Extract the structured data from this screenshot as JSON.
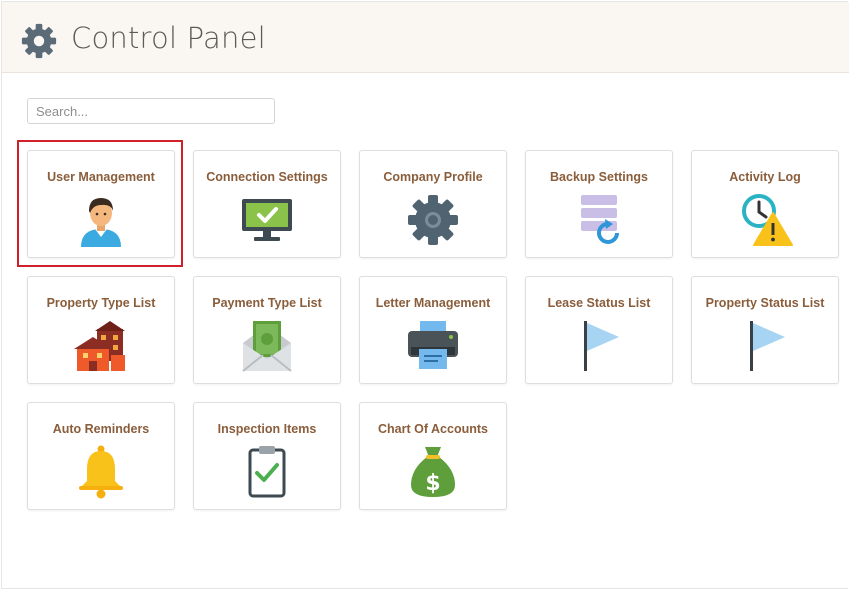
{
  "header": {
    "title": "Control Panel",
    "icon": "gear-icon"
  },
  "search": {
    "placeholder": "Search..."
  },
  "tiles": [
    {
      "label": "User Management",
      "icon": "user-icon",
      "selected": true
    },
    {
      "label": "Connection Settings",
      "icon": "monitor-check-icon"
    },
    {
      "label": "Company Profile",
      "icon": "gear-icon"
    },
    {
      "label": "Backup Settings",
      "icon": "database-restore-icon"
    },
    {
      "label": "Activity Log",
      "icon": "clock-warning-icon"
    },
    {
      "label": "Property Type List",
      "icon": "buildings-icon"
    },
    {
      "label": "Payment Type List",
      "icon": "money-envelope-icon"
    },
    {
      "label": "Letter Management",
      "icon": "printer-icon"
    },
    {
      "label": "Lease Status List",
      "icon": "flag-icon"
    },
    {
      "label": "Property Status List",
      "icon": "flag-icon"
    },
    {
      "label": "Auto Reminders",
      "icon": "bell-icon"
    },
    {
      "label": "Inspection Items",
      "icon": "clipboard-check-icon"
    },
    {
      "label": "Chart Of Accounts",
      "icon": "money-bag-icon"
    }
  ],
  "colors": {
    "highlight": "#d0202a",
    "tile_label": "#8a5d3b",
    "header_bg": "#faf6f2"
  }
}
